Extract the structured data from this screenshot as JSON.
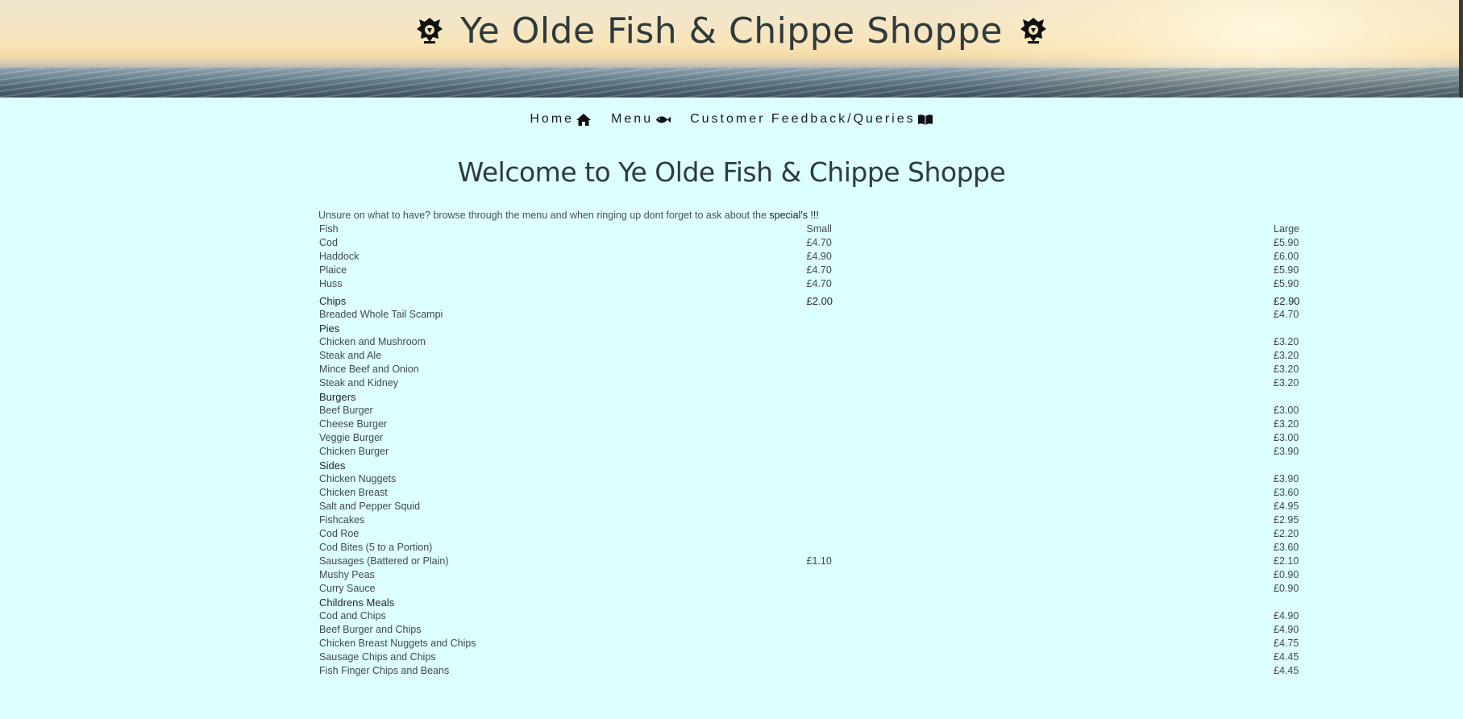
{
  "site": {
    "title": "Ye Olde Fish & Chippe Shoppe"
  },
  "nav": {
    "items": [
      {
        "label": "Home",
        "icon": "home-icon"
      },
      {
        "label": "Menu",
        "icon": "fish-icon"
      },
      {
        "label": "Customer Feedback/Queries",
        "icon": "book-icon"
      }
    ]
  },
  "main": {
    "heading": "Welcome to Ye Olde Fish & Chippe Shoppe",
    "intro_text": "Unsure on what to have? browse through the menu and when ringing up dont forget to ask about the ",
    "intro_emph": "special's !!!"
  },
  "menu": {
    "columns": {
      "item": "Fish",
      "small": "Small",
      "large": "Large"
    },
    "rows": [
      {
        "item": "Cod",
        "small": "£4.70",
        "large": "£5.90"
      },
      {
        "item": "Haddock",
        "small": "£4.90",
        "large": "£6.00"
      },
      {
        "item": "Plaice",
        "small": "£4.70",
        "large": "£5.90"
      },
      {
        "item": "Huss",
        "small": "£4.70",
        "large": "£5.90"
      },
      {
        "item": "Chips",
        "small": "£2.00",
        "large": "£2.90",
        "category": true
      },
      {
        "item": "Breaded Whole Tail Scampi",
        "small": "",
        "large": "£4.70"
      },
      {
        "item": "Pies",
        "small": "",
        "large": "",
        "category": true
      },
      {
        "item": "Chicken and Mushroom",
        "small": "",
        "large": "£3.20"
      },
      {
        "item": "Steak and Ale",
        "small": "",
        "large": "£3.20"
      },
      {
        "item": "Mince Beef and Onion",
        "small": "",
        "large": "£3.20"
      },
      {
        "item": "Steak and Kidney",
        "small": "",
        "large": "£3.20"
      },
      {
        "item": "Burgers",
        "small": "",
        "large": "",
        "category": true
      },
      {
        "item": "Beef Burger",
        "small": "",
        "large": "£3.00"
      },
      {
        "item": "Cheese Burger",
        "small": "",
        "large": "£3.20"
      },
      {
        "item": "Veggie Burger",
        "small": "",
        "large": "£3.00"
      },
      {
        "item": "Chicken Burger",
        "small": "",
        "large": "£3.90"
      },
      {
        "item": "Sides",
        "small": "",
        "large": "",
        "category": true
      },
      {
        "item": "Chicken Nuggets",
        "small": "",
        "large": "£3.90"
      },
      {
        "item": "Chicken Breast",
        "small": "",
        "large": "£3.60"
      },
      {
        "item": "Salt and Pepper Squid",
        "small": "",
        "large": "£4.95"
      },
      {
        "item": "Fishcakes",
        "small": "",
        "large": "£2.95"
      },
      {
        "item": "Cod Roe",
        "small": "",
        "large": "£2.20"
      },
      {
        "item": "Cod Bites (5 to a Portion)",
        "small": "",
        "large": "£3.60"
      },
      {
        "item": "Sausages (Battered or Plain)",
        "small": "£1.10",
        "large": "£2.10"
      },
      {
        "item": "Mushy Peas",
        "small": "",
        "large": "£0.90"
      },
      {
        "item": "Curry Sauce",
        "small": "",
        "large": "£0.90"
      },
      {
        "item": "Childrens Meals",
        "small": "",
        "large": "",
        "category": true
      },
      {
        "item": "Cod and Chips",
        "small": "",
        "large": "£4.90"
      },
      {
        "item": "Beef Burger and Chips",
        "small": "",
        "large": "£4.90"
      },
      {
        "item": "Chicken Breast Nuggets and Chips",
        "small": "",
        "large": "£4.75"
      },
      {
        "item": "Sausage Chips and Chips",
        "small": "",
        "large": "£4.45"
      },
      {
        "item": "Fish Finger Chips and Beans",
        "small": "",
        "large": "£4.45"
      }
    ]
  }
}
